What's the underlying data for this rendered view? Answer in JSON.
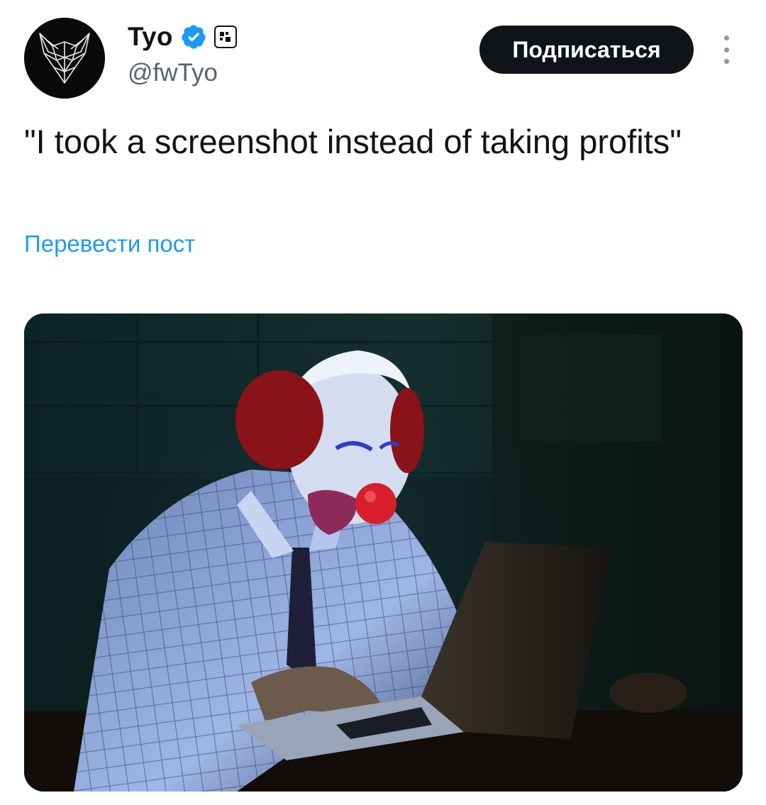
{
  "author": {
    "name": "Tyo",
    "handle": "@fwTyo",
    "avatar_icon": "wolf-logo-icon",
    "verified_icon": "verified-badge-icon",
    "affiliate_icon": "affiliate-badge-icon",
    "verified_color": "#1d9bf0"
  },
  "actions": {
    "follow_label": "Подписаться",
    "more_icon": "more-vertical-icon"
  },
  "tweet": {
    "text": "\"I took a screenshot instead of taking profits\"",
    "translate_label": "Перевести пост"
  },
  "media": {
    "kind": "photo"
  },
  "colors": {
    "text": "#0f1419",
    "secondary": "#536471",
    "link": "#1d9bf0",
    "button_bg": "#0f1419",
    "button_text": "#ffffff"
  }
}
